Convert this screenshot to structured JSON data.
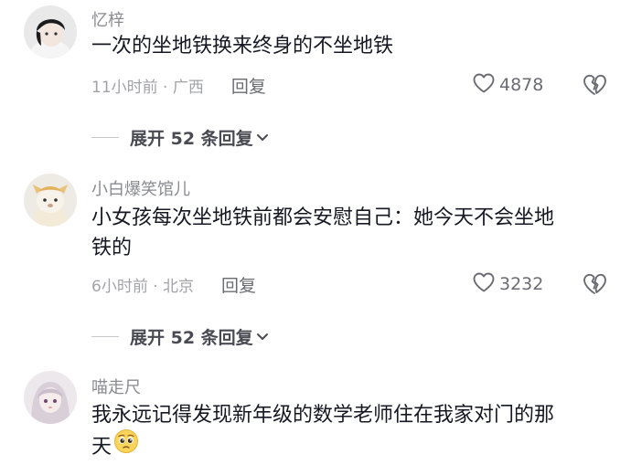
{
  "comments": [
    {
      "username": "忆梓",
      "content_lines": [
        "一次的坐地铁换来终身的不坐地铁"
      ],
      "time_location": "11小时前 · 广西",
      "reply_label": "回复",
      "like_count": "4878",
      "expand_label": "展开 52 条回复"
    },
    {
      "username": "小白爆笑馆儿",
      "content_lines": [
        "小女孩每次坐地铁前都会安慰自己：她今天不会坐地",
        "铁的"
      ],
      "time_location": "6小时前 · 北京",
      "reply_label": "回复",
      "like_count": "3232",
      "expand_label": "展开 52 条回复"
    },
    {
      "username": "喵走尺",
      "content_lines": [
        "我永远记得发现新年级的数学老师住在我家对门的那",
        "天"
      ]
    }
  ],
  "icons": {
    "like": "heart-outline-icon",
    "dislike": "broken-heart-icon",
    "expand": "chevron-down-icon",
    "emoji": "pleading-face-emoji"
  },
  "colors": {
    "text_primary": "#161823",
    "text_secondary": "#8a8b91",
    "text_meta": "#a2a3a8"
  }
}
